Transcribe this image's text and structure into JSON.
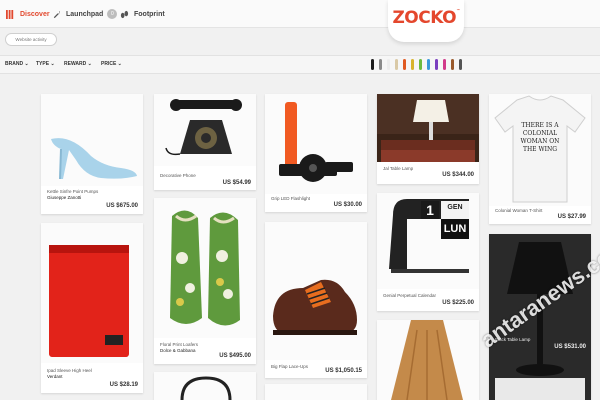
{
  "nav": {
    "discover": "Discover",
    "launchpad": "Launchpad",
    "launchpad_badge": "0",
    "footprint": "Footprint"
  },
  "logo": "ZOCKO",
  "logo_mark": "™",
  "website_button": "Website activity",
  "filters": [
    "BRAND",
    "TYPE",
    "REWARD",
    "PRICE"
  ],
  "filter_caret": "⌄",
  "swatch_colors": [
    "#1b1b1b",
    "#8a8a8a",
    "#ededed",
    "#d9c9a6",
    "#e05a22",
    "#d8b32c",
    "#6dbb3f",
    "#3a9ad9",
    "#7b3fbf",
    "#d23a8a",
    "#9a5a2c",
    "#555555"
  ],
  "products": [
    {
      "name": "Kettle Sinfre Point Pumps",
      "brand": "Giuseppe Zanotti",
      "price": "US $675.00"
    },
    {
      "name": "Decorative Phone",
      "brand": "",
      "price": "US $54.99"
    },
    {
      "name": "Grip LED Flashlight",
      "brand": "",
      "price": "US $30.00"
    },
    {
      "name": "Jal Table Lamp",
      "brand": "",
      "price": "US $344.00"
    },
    {
      "name": "Colonial Woman T-Shirt",
      "brand": "",
      "price": "US $27.99"
    },
    {
      "name": "Ipad Sleeve High Heel",
      "brand": "Verdant",
      "price": "US $28.19"
    },
    {
      "name": "Floral Print Loafers",
      "brand": "Dolce & Gabbana",
      "price": "US $495.00"
    },
    {
      "name": "Big Flap Lace-Ups",
      "brand": "",
      "price": "US $1,050.15"
    },
    {
      "name": "Genial Perpetual Calendar",
      "brand": "",
      "price": "US $225.00"
    },
    {
      "name": "Black Table Lamp",
      "brand": "",
      "price": "US $531.00"
    }
  ],
  "tshirt_text": "THERE IS A COLONIAL WOMAN ON THE WING",
  "calendar": {
    "day": "1",
    "month_short": "GEN",
    "month": "LUN"
  },
  "watermark": "antaranews.com"
}
